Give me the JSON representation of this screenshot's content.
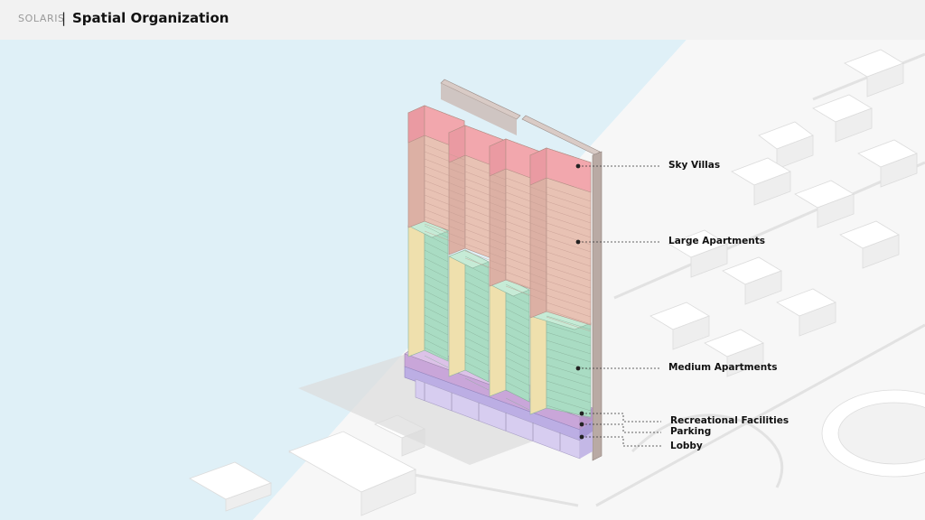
{
  "header": {
    "brand": "SOLARIS",
    "separator": "|",
    "title": "Spatial Organization"
  },
  "labels": {
    "sky_villas": "Sky Villas",
    "large_apartments": "Large Apartments",
    "medium_apartments": "Medium Apartments",
    "recreational_facilities": "Recreational Facilities",
    "parking": "Parking",
    "lobby": "Lobby"
  },
  "colors": {
    "water": "#dff0f7",
    "sky_villas": "#f2a7ad",
    "large_apartments": "#e8c2b4",
    "medium_apartments_front": "#a9dcc3",
    "medium_apartments_side": "#efe0ad",
    "recreational": "#c9a6d9",
    "parking": "#bcaee4",
    "lobby": "#d7cdf0",
    "core": "#c9b8b2"
  }
}
